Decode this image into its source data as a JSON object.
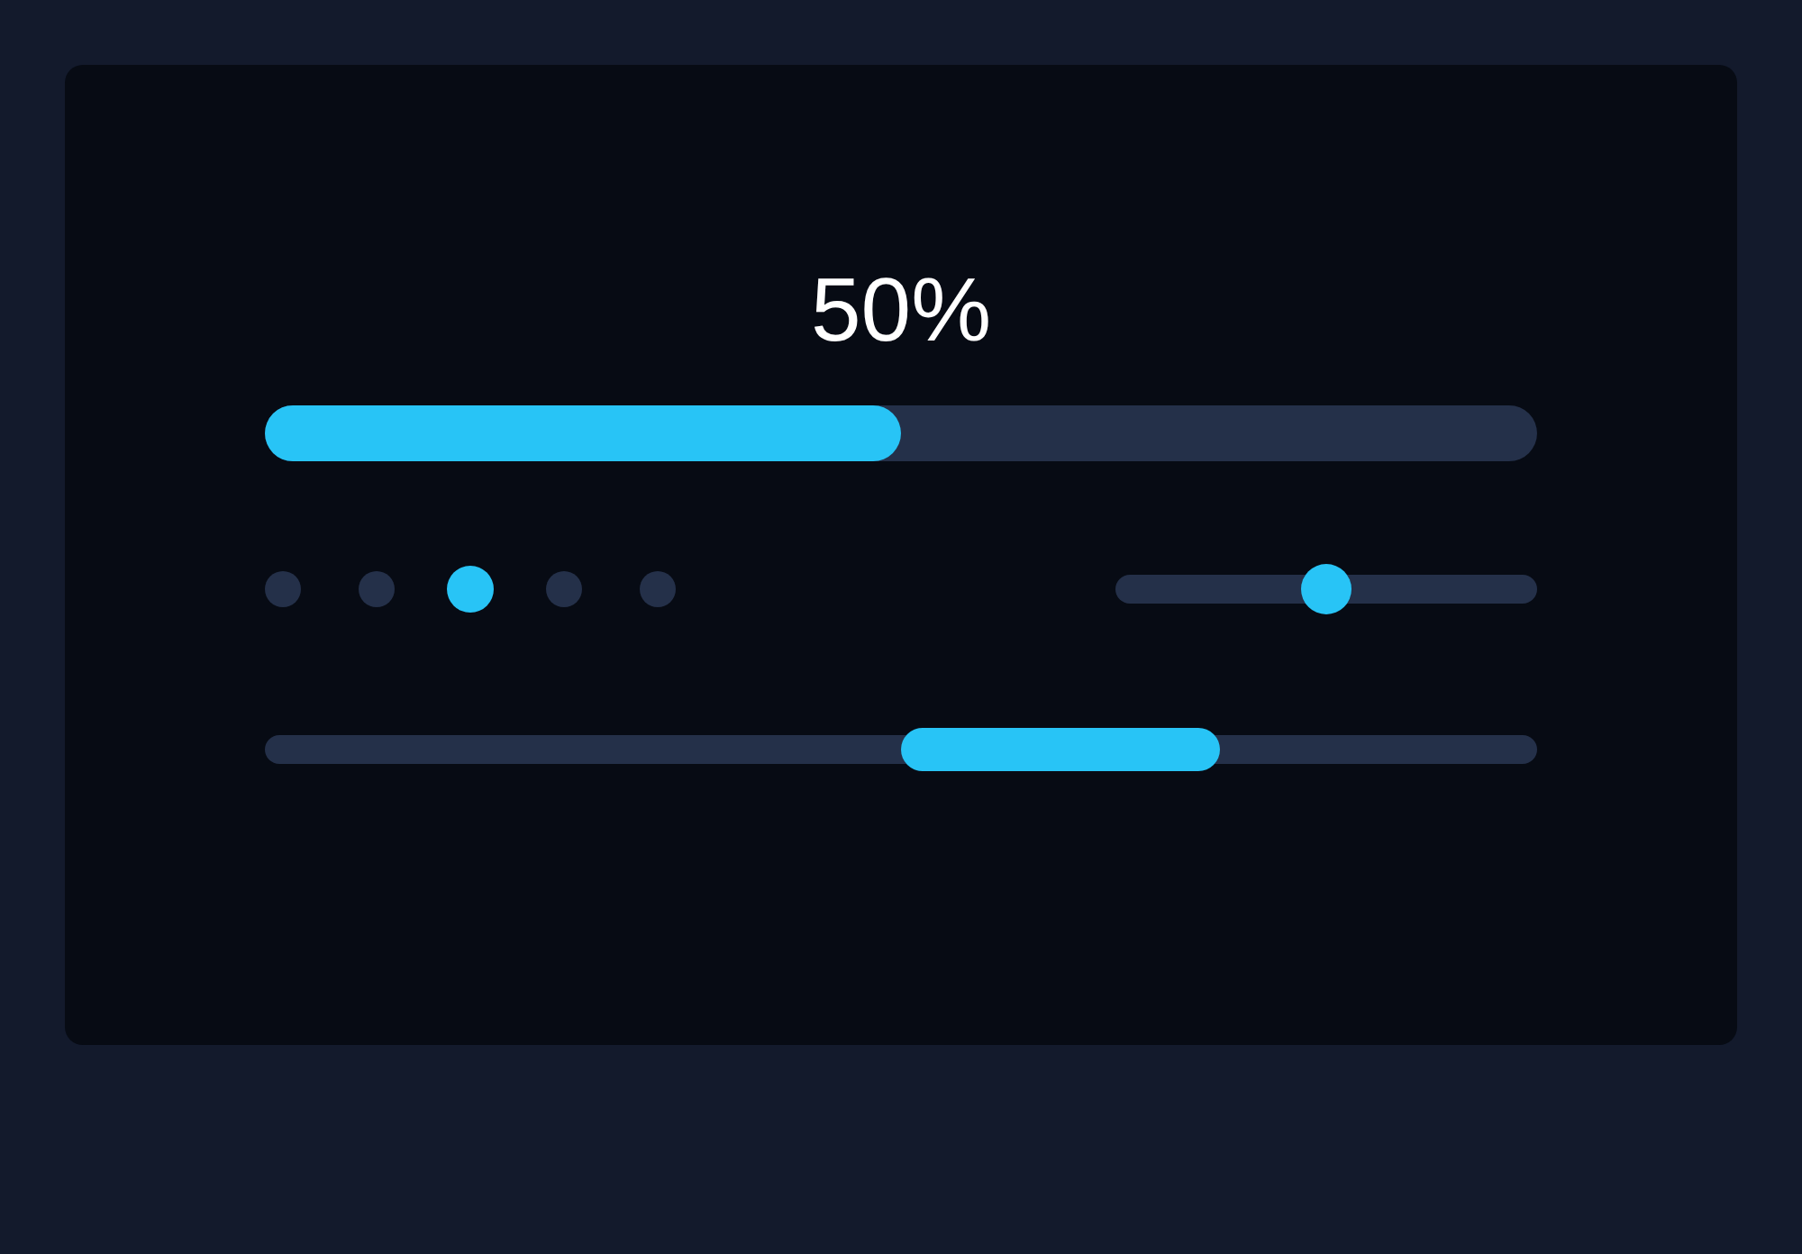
{
  "progress": {
    "label": "50%",
    "level": 0.5
  },
  "pagination": {
    "dots": [
      {
        "selected": false
      },
      {
        "selected": false
      },
      {
        "selected": true
      },
      {
        "selected": false
      },
      {
        "selected": false
      }
    ]
  },
  "slider": {
    "level": 0.5
  },
  "segment_bar": {
    "level": 0.625
  }
}
